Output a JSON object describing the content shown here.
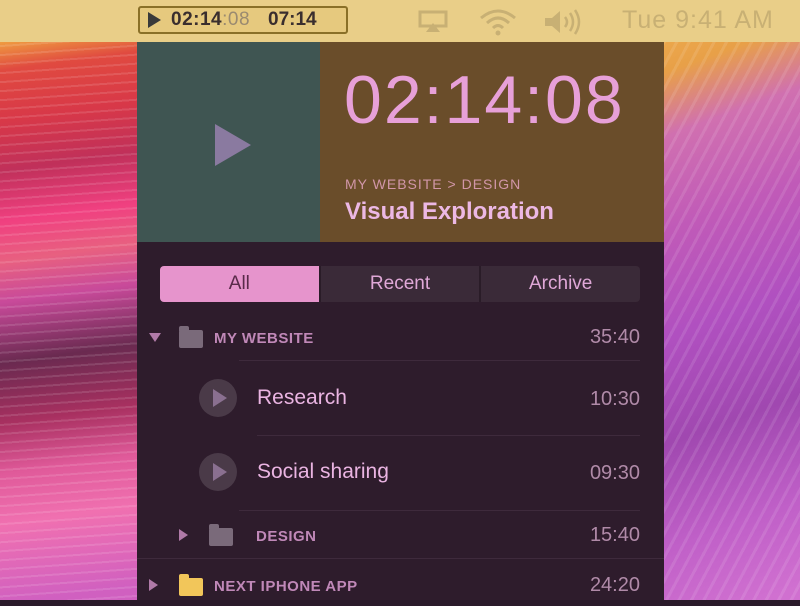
{
  "menubar": {
    "current_time_hm": "02:14",
    "current_time_sec": ":08",
    "total_time": "07:14",
    "clock": "Tue 9:41 AM"
  },
  "header": {
    "timer": "02:14:08",
    "breadcrumb": "MY WEBSITE > DESIGN",
    "title": "Visual Exploration"
  },
  "tabs": [
    {
      "label": "All",
      "active": true
    },
    {
      "label": "Recent",
      "active": false
    },
    {
      "label": "Archive",
      "active": false
    }
  ],
  "list": {
    "groups": [
      {
        "label": "MY WEBSITE",
        "duration": "35:40",
        "expanded": true,
        "tasks": [
          {
            "label": "Research",
            "duration": "10:30"
          },
          {
            "label": "Social sharing",
            "duration": "09:30"
          }
        ],
        "subgroups": [
          {
            "label": "DESIGN",
            "duration": "15:40",
            "expanded": false
          }
        ]
      },
      {
        "label": "NEXT IPHONE APP",
        "duration": "24:20",
        "expanded": false
      }
    ]
  },
  "colors": {
    "accent_pink": "#e694cc",
    "folder_dark": "#7a6a7a",
    "folder_yellow": "#f2c65a"
  }
}
